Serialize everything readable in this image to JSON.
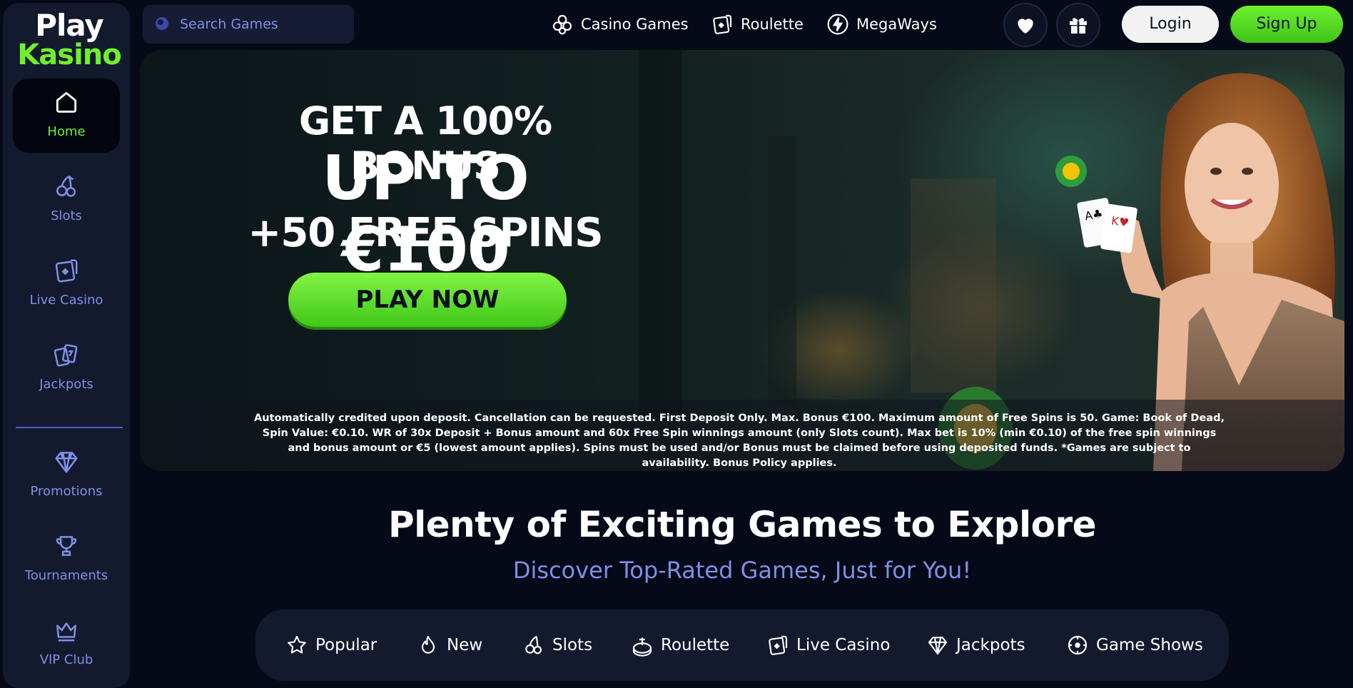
{
  "brand": {
    "line1": "Play",
    "line2": "Kasino",
    "accent": "#6ef02e"
  },
  "sidebar": {
    "items": [
      {
        "label": "Home",
        "icon": "home-icon",
        "active": true
      },
      {
        "label": "Slots",
        "icon": "cherry-icon"
      },
      {
        "label": "Live Casino",
        "icon": "card-icon"
      },
      {
        "label": "Jackpots",
        "icon": "cards-icon"
      },
      {
        "label": "Promotions",
        "icon": "diamond-icon"
      },
      {
        "label": "Tournaments",
        "icon": "trophy-icon"
      },
      {
        "label": "VIP Club",
        "icon": "crown-icon"
      }
    ]
  },
  "search": {
    "placeholder": "Search Games"
  },
  "topnav": {
    "casino_games": "Casino Games",
    "roulette": "Roulette",
    "megaways": "MegaWays"
  },
  "header": {
    "login": "Login",
    "signup": "Sign Up"
  },
  "hero": {
    "line1": "GET A 100% BONUS",
    "line2": "UP TO €100",
    "line3": "+50 FREE SPINS",
    "cta": "PLAY NOW",
    "terms": "Automatically credited upon deposit. Cancellation can be requested. First Deposit Only. Max. Bonus €100. Maximum amount of Free Spins is 50. Game: Book of Dead, Spin Value: €0.10. WR of 30x Deposit + Bonus amount and 60x Free Spin winnings amount (only Slots count). Max bet is 10% (min €0.10) of the free spin winnings and bonus amount or €5 (lowest amount applies). Spins must be used and/or Bonus must be claimed before using deposited funds. *Games are subject to availability. Bonus Policy applies."
  },
  "section": {
    "title": "Plenty of Exciting Games to Explore",
    "subtitle": "Discover Top-Rated Games, Just for You!"
  },
  "categories": {
    "popular": "Popular",
    "new": "New",
    "slots": "Slots",
    "roulette": "Roulette",
    "live_casino": "Live Casino",
    "jackpots": "Jackpots",
    "game_shows": "Game Shows"
  }
}
